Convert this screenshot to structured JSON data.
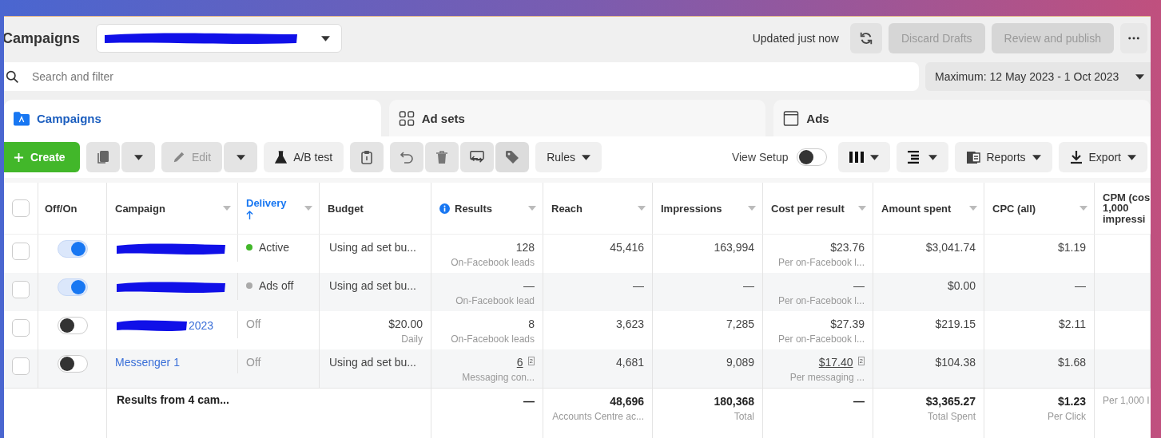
{
  "header": {
    "title": "Campaigns",
    "account": {
      "redacted": true
    },
    "updated": "Updated just now",
    "discard": {
      "label": "Discard Drafts",
      "disabled": true
    },
    "publish": {
      "label": "Review and publish",
      "disabled": true
    }
  },
  "search": {
    "placeholder": "Search and filter"
  },
  "date_range": "Maximum: 12 May 2023 - 1 Oct 2023",
  "tabs": [
    {
      "label": "Campaigns",
      "selected": true,
      "kind": "folder"
    },
    {
      "label": "Ad sets",
      "selected": false,
      "kind": "grid"
    },
    {
      "label": "Ads",
      "selected": false,
      "kind": "window"
    }
  ],
  "toolbar": {
    "create": "Create",
    "edit": {
      "label": "Edit",
      "disabled": true
    },
    "ab_test": "A/B test",
    "rules": "Rules",
    "view_setup": {
      "label": "View Setup",
      "on": false
    },
    "reports": "Reports",
    "export": "Export"
  },
  "table": {
    "all_checked": false,
    "columns": [
      {
        "label": "Off/On",
        "menu": false,
        "sorted": false,
        "info": false
      },
      {
        "label": "Campaign",
        "menu": true,
        "sorted": false,
        "info": false
      },
      {
        "label": "Delivery",
        "menu": true,
        "sorted": true,
        "info": false
      },
      {
        "label": "Budget",
        "menu": false,
        "sorted": false,
        "info": false
      },
      {
        "label": "Results",
        "menu": true,
        "sorted": false,
        "info": true
      },
      {
        "label": "Reach",
        "menu": true,
        "sorted": false,
        "info": false
      },
      {
        "label": "Impressions",
        "menu": true,
        "sorted": false,
        "info": false
      },
      {
        "label": "Cost per result",
        "menu": true,
        "sorted": false,
        "info": false
      },
      {
        "label": "Amount spent",
        "menu": true,
        "sorted": false,
        "info": false
      },
      {
        "label": "CPC (all)",
        "menu": true,
        "sorted": false,
        "info": false
      },
      {
        "label": "CPM (cos 1,000 impressi",
        "menu": false,
        "sorted": false,
        "info": false
      }
    ],
    "rows": [
      {
        "checked": false,
        "on": true,
        "campaign": {
          "redacted": true
        },
        "delivery": {
          "text": "Active",
          "color": "#42b72a"
        },
        "budget": {
          "value": "Using ad set bu..."
        },
        "results": {
          "value": "128",
          "sub": "On-Facebook leads"
        },
        "reach": "45,416",
        "impressions": "163,994",
        "cost": {
          "value": "$23.76",
          "sub": "Per on-Facebook l..."
        },
        "spent": "$3,041.74",
        "cpc": "$1.19"
      },
      {
        "checked": false,
        "on": true,
        "campaign": {
          "redacted": true
        },
        "delivery": {
          "text": "Ads off",
          "color": "#aaaaaa"
        },
        "budget": {
          "value": "Using ad set bu..."
        },
        "results": {
          "value": "—",
          "sub": "On-Facebook lead"
        },
        "reach": "—",
        "impressions": "—",
        "cost": {
          "value": "—",
          "sub": "Per on-Facebook l..."
        },
        "spent": "$0.00",
        "cpc": "—"
      },
      {
        "checked": false,
        "on": false,
        "campaign": {
          "redacted": true,
          "name": "2023"
        },
        "delivery": {
          "text": "Off"
        },
        "budget": {
          "value": "$20.00",
          "sub": "Daily"
        },
        "results": {
          "value": "8",
          "sub": "On-Facebook leads"
        },
        "reach": "3,623",
        "impressions": "7,285",
        "cost": {
          "value": "$27.39",
          "sub": "Per on-Facebook l..."
        },
        "spent": "$219.15",
        "cpc": "$2.11"
      },
      {
        "checked": false,
        "on": false,
        "campaign": {
          "redacted": false,
          "name": "Messenger 1"
        },
        "delivery": {
          "text": "Off"
        },
        "budget": {
          "value": "Using ad set bu..."
        },
        "results": {
          "value": "6",
          "note": "2",
          "sub": "Messaging con..."
        },
        "reach": "4,681",
        "impressions": "9,089",
        "cost": {
          "value": "$17.40",
          "note": "2",
          "sub": "Per messaging ..."
        },
        "spent": "$104.38",
        "cpc": "$1.68"
      }
    ],
    "totals": {
      "label": "Results from 4 cam...",
      "results": {
        "value": "—"
      },
      "reach": {
        "value": "48,696",
        "sub": "Accounts Centre ac..."
      },
      "impressions": {
        "value": "180,368",
        "sub": "Total"
      },
      "cost": {
        "value": "—"
      },
      "spent": {
        "value": "$3,365.27",
        "sub": "Total Spent"
      },
      "cpc": {
        "value": "$1.23",
        "sub": "Per Click"
      },
      "cpm": {
        "sub": "Per 1,000 I"
      }
    }
  }
}
